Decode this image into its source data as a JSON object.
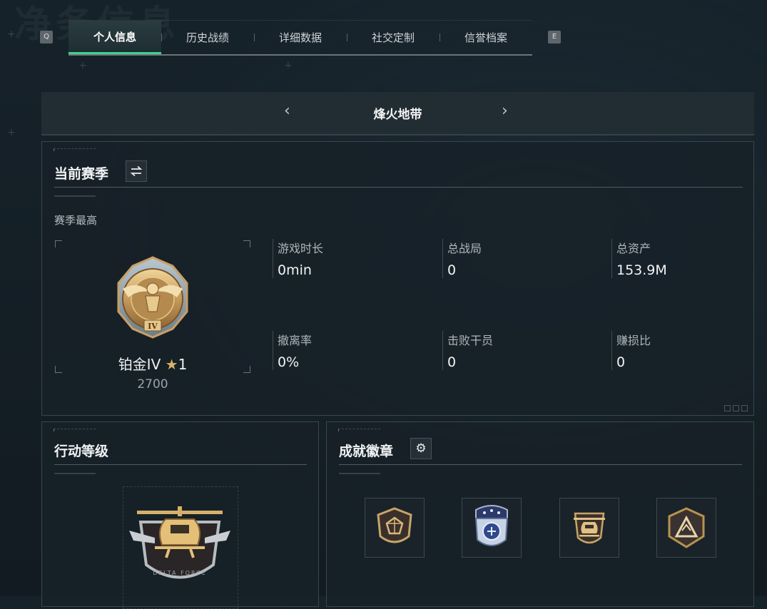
{
  "background": {
    "title": "净务信息"
  },
  "keys": {
    "left": "Q",
    "right": "E"
  },
  "tabs": [
    "个人信息",
    "历史战绩",
    "详细数据",
    "社交定制",
    "信誉档案"
  ],
  "mode": {
    "title": "烽火地带"
  },
  "season": {
    "title": "当前赛季",
    "best_label": "赛季最高",
    "rank_name": "铂金IV",
    "rank_stars": "1",
    "rank_score": "2700",
    "rank_numeral": "IV",
    "stats": [
      {
        "label": "游戏时长",
        "value": "0min"
      },
      {
        "label": "总战局",
        "value": "0"
      },
      {
        "label": "总资产",
        "value": "153.9M"
      },
      {
        "label": "撤离率",
        "value": "0%"
      },
      {
        "label": "击败干员",
        "value": "0"
      },
      {
        "label": "赚损比",
        "value": "0"
      }
    ]
  },
  "operation": {
    "title": "行动等级",
    "emblem_text": "DELTA FORCE"
  },
  "achievements": {
    "title": "成就徽章",
    "badges": [
      "gem-shield-badge",
      "star-police-badge",
      "helicopter-badge",
      "triangle-badge"
    ]
  },
  "colors": {
    "accent": "#3fd28e",
    "gold": "#c9a062"
  }
}
